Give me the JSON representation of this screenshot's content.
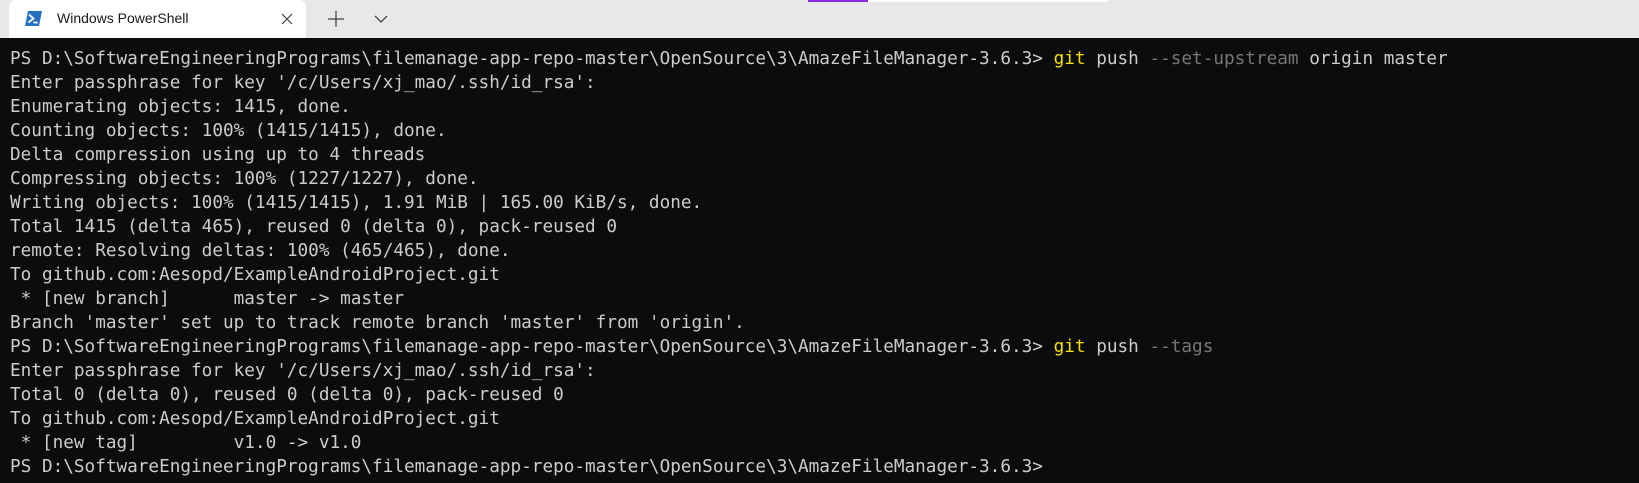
{
  "window": {
    "tab_title": "Windows PowerShell",
    "tab_icon": "powershell-icon",
    "close_icon": "close-icon",
    "new_tab_icon": "plus-icon",
    "dropdown_icon": "chevron-down-icon"
  },
  "colors": {
    "background": "#0c0c0c",
    "text": "#cccccc",
    "command": "#f5e100",
    "flag": "#767676",
    "tabbar": "#e8e8e8"
  },
  "terminal": {
    "lines": [
      {
        "segments": [
          {
            "type": "text",
            "text": "PS D:\\SoftwareEngineeringPrograms\\filemanage-app-repo-master\\OpenSource\\3\\AmazeFileManager-3.6.3> "
          },
          {
            "type": "cmd",
            "text": "git"
          },
          {
            "type": "text",
            "text": " push "
          },
          {
            "type": "flag",
            "text": "--set-upstream"
          },
          {
            "type": "text",
            "text": " origin master"
          }
        ]
      },
      {
        "segments": [
          {
            "type": "text",
            "text": "Enter passphrase for key '/c/Users/xj_mao/.ssh/id_rsa':"
          }
        ]
      },
      {
        "segments": [
          {
            "type": "text",
            "text": "Enumerating objects: 1415, done."
          }
        ]
      },
      {
        "segments": [
          {
            "type": "text",
            "text": "Counting objects: 100% (1415/1415), done."
          }
        ]
      },
      {
        "segments": [
          {
            "type": "text",
            "text": "Delta compression using up to 4 threads"
          }
        ]
      },
      {
        "segments": [
          {
            "type": "text",
            "text": "Compressing objects: 100% (1227/1227), done."
          }
        ]
      },
      {
        "segments": [
          {
            "type": "text",
            "text": "Writing objects: 100% (1415/1415), 1.91 MiB | 165.00 KiB/s, done."
          }
        ]
      },
      {
        "segments": [
          {
            "type": "text",
            "text": "Total 1415 (delta 465), reused 0 (delta 0), pack-reused 0"
          }
        ]
      },
      {
        "segments": [
          {
            "type": "text",
            "text": "remote: Resolving deltas: 100% (465/465), done."
          }
        ]
      },
      {
        "segments": [
          {
            "type": "text",
            "text": "To github.com:Aesopd/ExampleAndroidProject.git"
          }
        ]
      },
      {
        "segments": [
          {
            "type": "text",
            "text": " * [new branch]      master -> master"
          }
        ]
      },
      {
        "segments": [
          {
            "type": "text",
            "text": "Branch 'master' set up to track remote branch 'master' from 'origin'."
          }
        ]
      },
      {
        "segments": [
          {
            "type": "text",
            "text": "PS D:\\SoftwareEngineeringPrograms\\filemanage-app-repo-master\\OpenSource\\3\\AmazeFileManager-3.6.3> "
          },
          {
            "type": "cmd",
            "text": "git"
          },
          {
            "type": "text",
            "text": " push "
          },
          {
            "type": "flag",
            "text": "--tags"
          }
        ]
      },
      {
        "segments": [
          {
            "type": "text",
            "text": "Enter passphrase for key '/c/Users/xj_mao/.ssh/id_rsa':"
          }
        ]
      },
      {
        "segments": [
          {
            "type": "text",
            "text": "Total 0 (delta 0), reused 0 (delta 0), pack-reused 0"
          }
        ]
      },
      {
        "segments": [
          {
            "type": "text",
            "text": "To github.com:Aesopd/ExampleAndroidProject.git"
          }
        ]
      },
      {
        "segments": [
          {
            "type": "text",
            "text": " * [new tag]         v1.0 -> v1.0"
          }
        ]
      },
      {
        "segments": [
          {
            "type": "text",
            "text": "PS D:\\SoftwareEngineeringPrograms\\filemanage-app-repo-master\\OpenSource\\3\\AmazeFileManager-3.6.3>"
          }
        ]
      }
    ]
  }
}
